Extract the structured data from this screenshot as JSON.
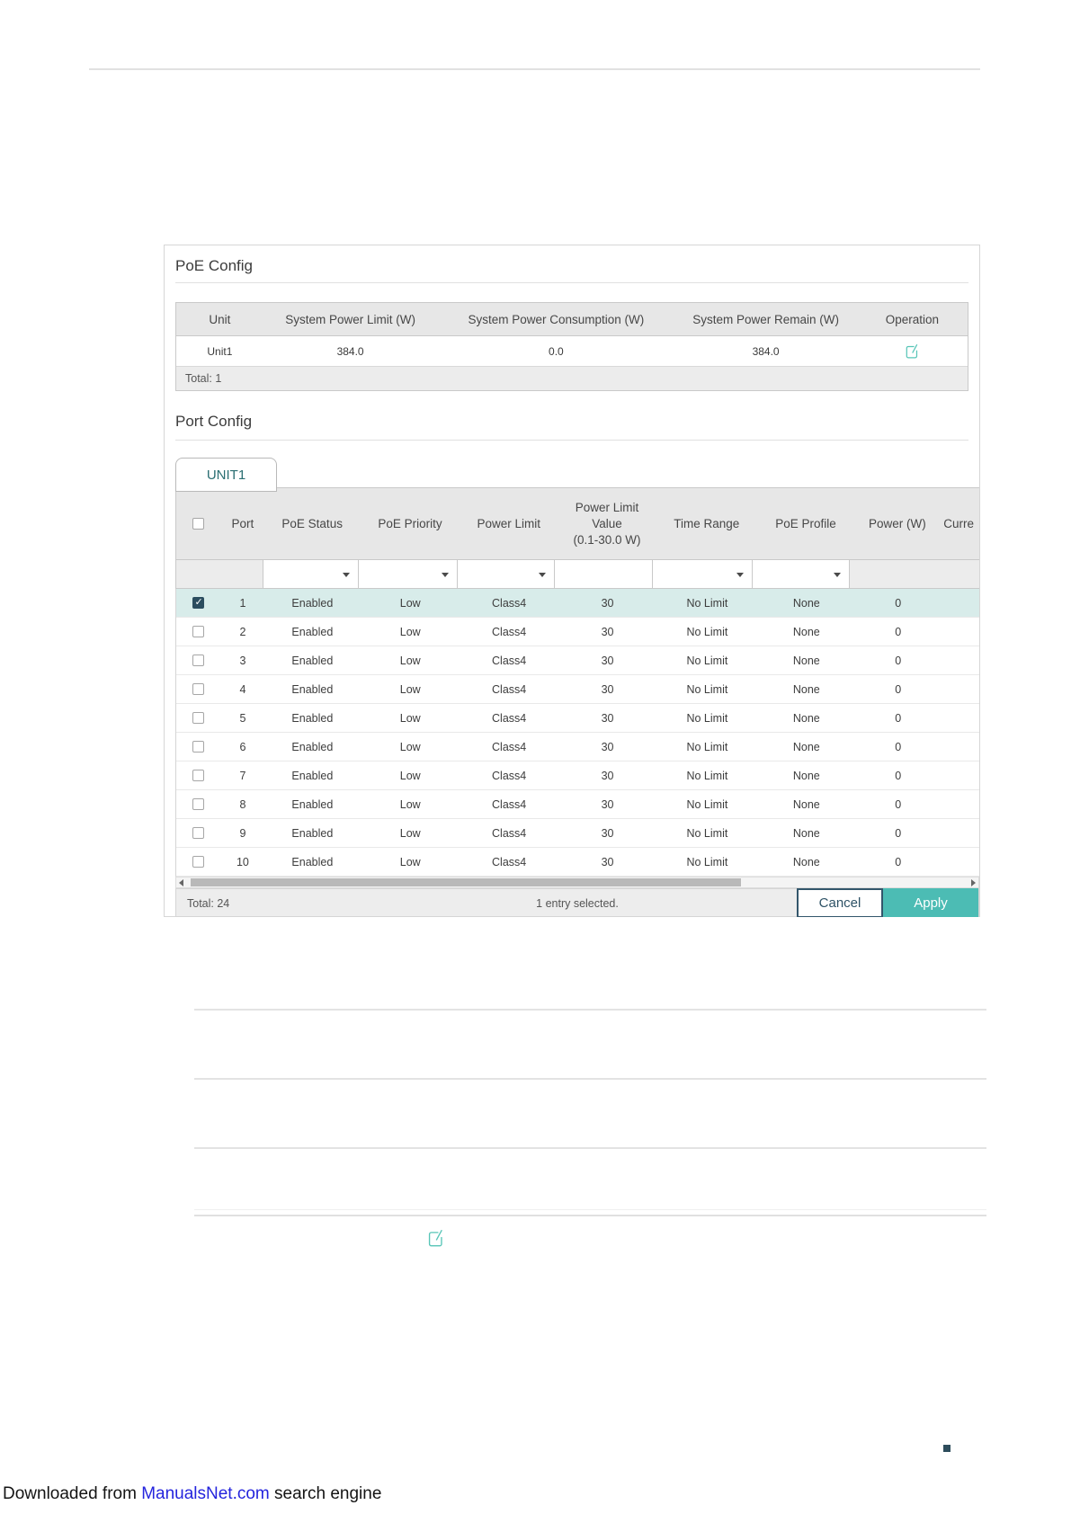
{
  "poe_config": {
    "title": "PoE Config",
    "columns": [
      "Unit",
      "System Power Limit (W)",
      "System Power Consumption (W)",
      "System Power Remain (W)",
      "Operation"
    ],
    "row": {
      "unit": "Unit1",
      "limit": "384.0",
      "consumption": "0.0",
      "remain": "384.0"
    },
    "total": "Total: 1"
  },
  "port_config": {
    "title": "Port Config",
    "tab": "UNIT1",
    "headers": {
      "port": "Port",
      "status": "PoE Status",
      "priority": "PoE Priority",
      "limit": "Power Limit",
      "value_line1": "Power Limit",
      "value_line2": "Value",
      "value_line3": "(0.1-30.0 W)",
      "time": "Time Range",
      "profile": "PoE Profile",
      "power": "Power (W)",
      "current": "Curre"
    },
    "rows": [
      {
        "port": "1",
        "status": "Enabled",
        "priority": "Low",
        "limit": "Class4",
        "value": "30",
        "time": "No Limit",
        "profile": "None",
        "power": "0",
        "selected": true
      },
      {
        "port": "2",
        "status": "Enabled",
        "priority": "Low",
        "limit": "Class4",
        "value": "30",
        "time": "No Limit",
        "profile": "None",
        "power": "0",
        "selected": false
      },
      {
        "port": "3",
        "status": "Enabled",
        "priority": "Low",
        "limit": "Class4",
        "value": "30",
        "time": "No Limit",
        "profile": "None",
        "power": "0",
        "selected": false
      },
      {
        "port": "4",
        "status": "Enabled",
        "priority": "Low",
        "limit": "Class4",
        "value": "30",
        "time": "No Limit",
        "profile": "None",
        "power": "0",
        "selected": false
      },
      {
        "port": "5",
        "status": "Enabled",
        "priority": "Low",
        "limit": "Class4",
        "value": "30",
        "time": "No Limit",
        "profile": "None",
        "power": "0",
        "selected": false
      },
      {
        "port": "6",
        "status": "Enabled",
        "priority": "Low",
        "limit": "Class4",
        "value": "30",
        "time": "No Limit",
        "profile": "None",
        "power": "0",
        "selected": false
      },
      {
        "port": "7",
        "status": "Enabled",
        "priority": "Low",
        "limit": "Class4",
        "value": "30",
        "time": "No Limit",
        "profile": "None",
        "power": "0",
        "selected": false
      },
      {
        "port": "8",
        "status": "Enabled",
        "priority": "Low",
        "limit": "Class4",
        "value": "30",
        "time": "No Limit",
        "profile": "None",
        "power": "0",
        "selected": false
      },
      {
        "port": "9",
        "status": "Enabled",
        "priority": "Low",
        "limit": "Class4",
        "value": "30",
        "time": "No Limit",
        "profile": "None",
        "power": "0",
        "selected": false
      },
      {
        "port": "10",
        "status": "Enabled",
        "priority": "Low",
        "limit": "Class4",
        "value": "30",
        "time": "No Limit",
        "profile": "None",
        "power": "0",
        "selected": false
      }
    ],
    "total": "Total: 24",
    "selection": "1 entry selected.",
    "cancel_label": "Cancel",
    "apply_label": "Apply"
  },
  "page": {
    "footer_prefix": "Downloaded from ",
    "footer_link": "ManualsNet.com",
    "footer_suffix": " search engine"
  },
  "colors": {
    "accent_teal": "#4cbcb4",
    "row_highlight": "#d8ecea",
    "checkbox_checked": "#2b4d5f",
    "tab_text": "#2a6e72",
    "icon_teal": "#57c5b7",
    "cancel_border": "#33566b",
    "link_blue": "#2424dd",
    "bullet": "#2e4d5c"
  }
}
